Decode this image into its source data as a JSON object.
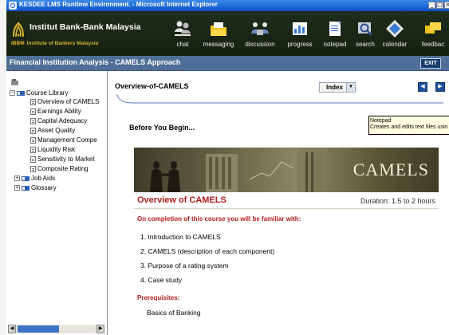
{
  "window": {
    "title": "KESDEE LMS Runtime Environment. - Microsoft Internet Explorer"
  },
  "header": {
    "org_name": "Institut Bank-Bank Malaysia",
    "org_sub": "Institute of Bankers Malaysia",
    "logo_mark": "IBBM",
    "tools": [
      {
        "label": "chat",
        "icon": "chat-icon"
      },
      {
        "label": "messaging",
        "icon": "messaging-icon"
      },
      {
        "label": "discussion",
        "icon": "discussion-icon"
      },
      {
        "label": "progress",
        "icon": "progress-icon"
      },
      {
        "label": "notepad",
        "icon": "notepad-icon"
      },
      {
        "label": "search",
        "icon": "search-icon"
      },
      {
        "label": "calendar",
        "icon": "calendar-icon"
      },
      {
        "label": "feedbac",
        "icon": "feedback-icon"
      }
    ]
  },
  "course": {
    "title": "Financial Institution Analysis - CAMELS Approach",
    "exit_label": "EXIT"
  },
  "sidebar": {
    "root": "Course Library",
    "items": [
      "Overview of CAMELS",
      "Earnings Ability",
      "Capital Adequacy",
      "Asset Quality",
      "Management Compe",
      "Liquidity Risk",
      "Sensitivity to Market",
      "Composite Rating"
    ],
    "folders": [
      "Job Aids",
      "Glossary"
    ]
  },
  "content": {
    "page_title": "Overview-of-CAMELS",
    "index_label": "Index",
    "before_begin": "Before You Begin...",
    "tooltip_title": "Notepad",
    "tooltip_text": "Creates and edits text files usin",
    "banner_text": "CAMELS",
    "section_title": "Overview of CAMELS",
    "duration": "Duration: 1.5 to 2 hours",
    "intro": "On completion of this course you will be familiar with:",
    "objectives": [
      "1.  Introduction to CAMELS",
      "2.  CAMELS (description of each component)",
      "3.  Purpose of a rating system",
      "4.  Case study"
    ],
    "prereq_label": "Prerequisites:",
    "prereq_value": "Basics of Banking"
  },
  "colors": {
    "header_bg": "#1c2818",
    "course_bar": "#506f98",
    "accent_red": "#b01c1c",
    "nav_blue": "#1c4f9c"
  }
}
